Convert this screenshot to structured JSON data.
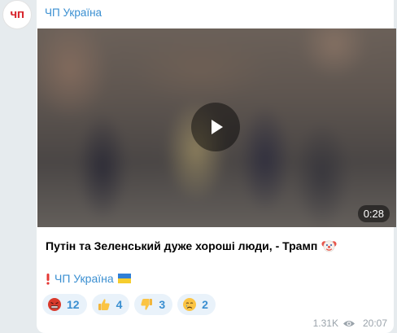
{
  "avatar": {
    "text": "ЧП"
  },
  "message": {
    "channel_name": "ЧП Україна",
    "video": {
      "duration": "0:28"
    },
    "caption": "Путін та Зеленський дуже хороші люди, - Трамп",
    "signature": {
      "link": "ЧП Україна"
    },
    "reactions": [
      {
        "emoji": "angry-face-icon",
        "count": "12"
      },
      {
        "emoji": "thumbs-up-icon",
        "count": "4"
      },
      {
        "emoji": "thumbs-down-icon",
        "count": "3"
      },
      {
        "emoji": "crying-face-icon",
        "count": "2"
      }
    ],
    "views": "1.31K",
    "time": "20:07"
  }
}
